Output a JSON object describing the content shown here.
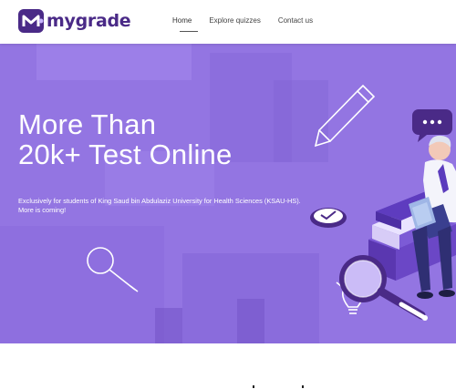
{
  "brand": {
    "name": "mygrade",
    "logo_letter": "M",
    "color": "#4a2a87"
  },
  "nav": {
    "items": [
      {
        "label": "Home",
        "active": true
      },
      {
        "label": "Explore quizzes",
        "active": false
      },
      {
        "label": "Contact us",
        "active": false
      }
    ]
  },
  "hero": {
    "title_line1": "More Than",
    "title_line2": "20k+ Test Online",
    "description": "Exclusively for students of King Saud bin Abdulaziz University for Health Sciences (KSAU-HS). More is coming!",
    "background_color": "#8f6fe0",
    "icons": [
      "pencil-icon",
      "chat-bubble-icon",
      "magnifier-icon",
      "lightbulb-icon",
      "clock-icon",
      "student-with-laptop-illustration"
    ]
  }
}
